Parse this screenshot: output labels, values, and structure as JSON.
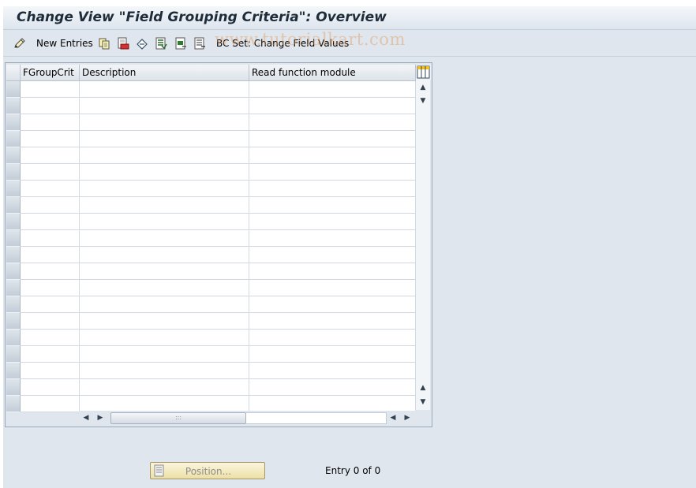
{
  "window": {
    "title": "Change View \"Field Grouping Criteria\": Overview"
  },
  "toolbar": {
    "items": [
      {
        "icon": "edit-pencil-icon"
      },
      {
        "label": "New Entries"
      },
      {
        "icon": "copy-icon"
      },
      {
        "icon": "delete-icon"
      },
      {
        "icon": "undo-icon"
      },
      {
        "icon": "select-all-icon"
      },
      {
        "icon": "select-block-icon"
      },
      {
        "icon": "deselect-all-icon"
      },
      {
        "label": "BC Set: Change Field Values"
      }
    ]
  },
  "watermark": "www.tutorialkart.com",
  "table": {
    "columns": [
      "FGroupCrit",
      "Description",
      "Read function module"
    ],
    "row_count": 20,
    "rows": []
  },
  "footer": {
    "position_button": "Position...",
    "entry_text": "Entry 0 of 0"
  },
  "colors": {
    "title_bar": "#dde5ee",
    "toolbar": "#dfe6ee",
    "position_button": "#f3eac1",
    "watermark": "#e29650"
  }
}
